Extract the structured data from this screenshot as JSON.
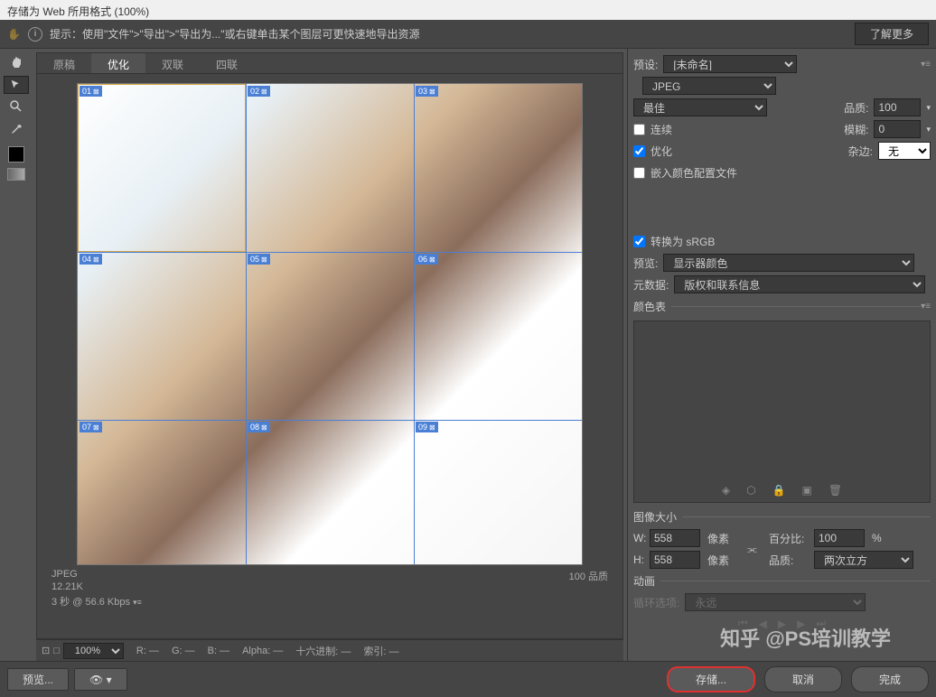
{
  "title": "存储为 Web 所用格式 (100%)",
  "tip": {
    "text": "提示：使用\"文件\">\"导出\">\"导出为...\"或右键单击某个图层可更快速地导出资源",
    "button": "了解更多"
  },
  "tabs": [
    "原稿",
    "优化",
    "双联",
    "四联"
  ],
  "active_tab": 1,
  "slices": [
    "01",
    "02",
    "03",
    "04",
    "05",
    "06",
    "07",
    "08",
    "09"
  ],
  "status": {
    "format": "JPEG",
    "size": "12.21K",
    "time": "3 秒 @ 56.6 Kbps",
    "quality": "100 品质"
  },
  "bottombar": {
    "zoom": "100%",
    "r": "R: —",
    "g": "G: —",
    "b": "B: —",
    "alpha": "Alpha: —",
    "hex": "十六进制: —",
    "index": "索引: —"
  },
  "preset": {
    "label": "预设:",
    "value": "[未命名]"
  },
  "format": "JPEG",
  "quality_preset": "最佳",
  "quality": {
    "label": "品质:",
    "value": "100"
  },
  "progressive": {
    "label": "连续"
  },
  "blur": {
    "label": "模糊:",
    "value": "0"
  },
  "optimized": {
    "label": "优化"
  },
  "matte": {
    "label": "杂边:",
    "value": "无"
  },
  "embed": {
    "label": "嵌入颜色配置文件"
  },
  "srgb": {
    "label": "转换为 sRGB"
  },
  "preview": {
    "label": "预览:",
    "value": "显示器颜色"
  },
  "metadata": {
    "label": "元数据:",
    "value": "版权和联系信息"
  },
  "color_table": "颜色表",
  "image_size": {
    "title": "图像大小",
    "w": "W:",
    "w_val": "558",
    "h": "H:",
    "h_val": "558",
    "px": "像素",
    "percent": "百分比:",
    "percent_val": "100",
    "pct": "%",
    "quality": "品质:",
    "quality_val": "两次立方"
  },
  "anim": {
    "title": "动画",
    "loop": "循环选项:",
    "loop_val": "永远"
  },
  "footer": {
    "preview": "预览...",
    "save": "存储...",
    "cancel": "取消",
    "done": "完成"
  },
  "watermark": "知乎 @PS培训教学"
}
